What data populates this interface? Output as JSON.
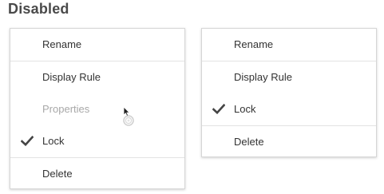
{
  "section": {
    "title": "Disabled"
  },
  "menu_left": {
    "items": [
      {
        "label": "Rename"
      },
      {
        "label": "Display Rule"
      },
      {
        "label": "Properties",
        "disabled": true
      },
      {
        "label": "Lock",
        "checked": true
      },
      {
        "label": "Delete"
      }
    ]
  },
  "menu_right": {
    "items": [
      {
        "label": "Rename"
      },
      {
        "label": "Display Rule"
      },
      {
        "label": "Lock",
        "checked": true
      },
      {
        "label": "Delete"
      }
    ]
  },
  "colors": {
    "text": "#333333",
    "disabled_text": "#a8a8a8",
    "heading": "#4a4a4a",
    "border": "#d6d6d6"
  },
  "icons": {
    "check": "check-icon",
    "cursor": "busy-cursor-icon"
  }
}
